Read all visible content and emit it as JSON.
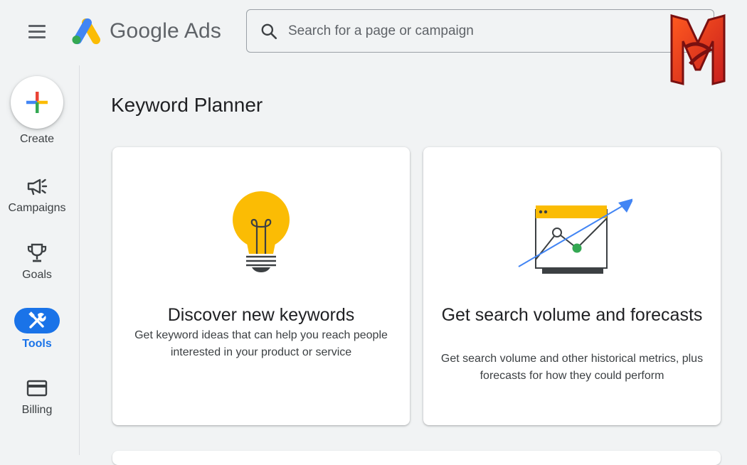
{
  "header": {
    "app_name": "Google Ads",
    "search_placeholder": "Search for a page or campaign"
  },
  "sidebar": {
    "items": [
      {
        "label": "Create",
        "icon": "plus-icon"
      },
      {
        "label": "Campaigns",
        "icon": "megaphone-icon"
      },
      {
        "label": "Goals",
        "icon": "trophy-icon"
      },
      {
        "label": "Tools",
        "icon": "tools-icon",
        "active": true
      },
      {
        "label": "Billing",
        "icon": "credit-card-icon"
      }
    ]
  },
  "main": {
    "title": "Keyword Planner",
    "cards": [
      {
        "title": "Discover new keywords",
        "description": "Get keyword ideas that can help you reach people interested in your product or service",
        "icon": "lightbulb-icon"
      },
      {
        "title": "Get search volume and forecasts",
        "description": "Get search volume and other historical metrics, plus forecasts for how they could perform",
        "icon": "forecast-chart-icon"
      }
    ]
  },
  "colors": {
    "accent": "#1a73e8",
    "google_blue": "#4285f4",
    "google_red": "#ea4335",
    "google_yellow": "#fbbc04",
    "google_green": "#34a853",
    "background": "#f1f3f4"
  }
}
